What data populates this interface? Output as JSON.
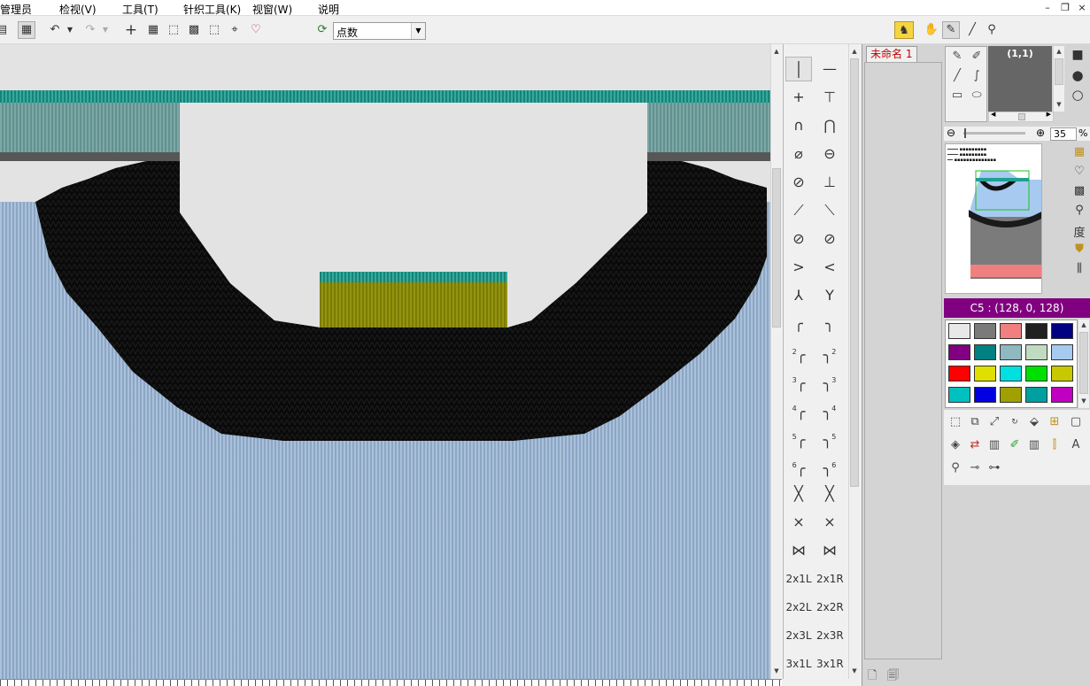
{
  "menu": {
    "items": [
      "管理员",
      "检视(V)",
      "工具(T)",
      "针织工具(K)",
      "视窗(W)",
      "说明"
    ]
  },
  "window_controls": {
    "minimize": "–",
    "restore": "❐",
    "close": "×"
  },
  "toolbar": {
    "mode_select_value": "点数",
    "icons": [
      "save-icon",
      "check-grid-icon",
      "undo-icon",
      "redo-icon",
      "cross-icon",
      "grid-icon",
      "select-icon",
      "pattern-icon",
      "region-icon",
      "lasso-icon",
      "mask-icon",
      "refresh-icon"
    ]
  },
  "top_right_tools": {
    "icons": [
      "knit-garment-icon",
      "hand-icon",
      "eyedropper-icon",
      "line-icon",
      "needle-icon"
    ]
  },
  "stitch_panel": {
    "text_symbols": [
      {
        "left": "2x1L",
        "right": "2x1R"
      },
      {
        "left": "2x2L",
        "right": "2x2R"
      },
      {
        "left": "2x3L",
        "right": "2x3R"
      },
      {
        "left": "3x1L",
        "right": "3x1R"
      }
    ],
    "numbered_symbols": [
      "2",
      "3",
      "4",
      "5",
      "6"
    ]
  },
  "file_panel": {
    "tab_label": "未命名 1"
  },
  "navigator": {
    "coord": "(1,1)",
    "zoom_value": "35",
    "zoom_unit": "%"
  },
  "side_labels": {
    "degree": "度"
  },
  "color_info": {
    "label": "C5 : (128, 0, 128)",
    "accent": "#800080"
  },
  "palette": {
    "colors": [
      "#e8e8e8",
      "#7a7a7a",
      "#f08080",
      "#202020",
      "#000080",
      "#800080",
      "#008080",
      "#8fb8c0",
      "#c0dcc0",
      "#a6caf0",
      "#ff0000",
      "#e0e000",
      "#00e0e0",
      "#00e000",
      "#c8c800",
      "#00c0c0",
      "#0000e0",
      "#a0a000",
      "#00a0a0",
      "#c000c0"
    ],
    "selected_index": 5
  }
}
